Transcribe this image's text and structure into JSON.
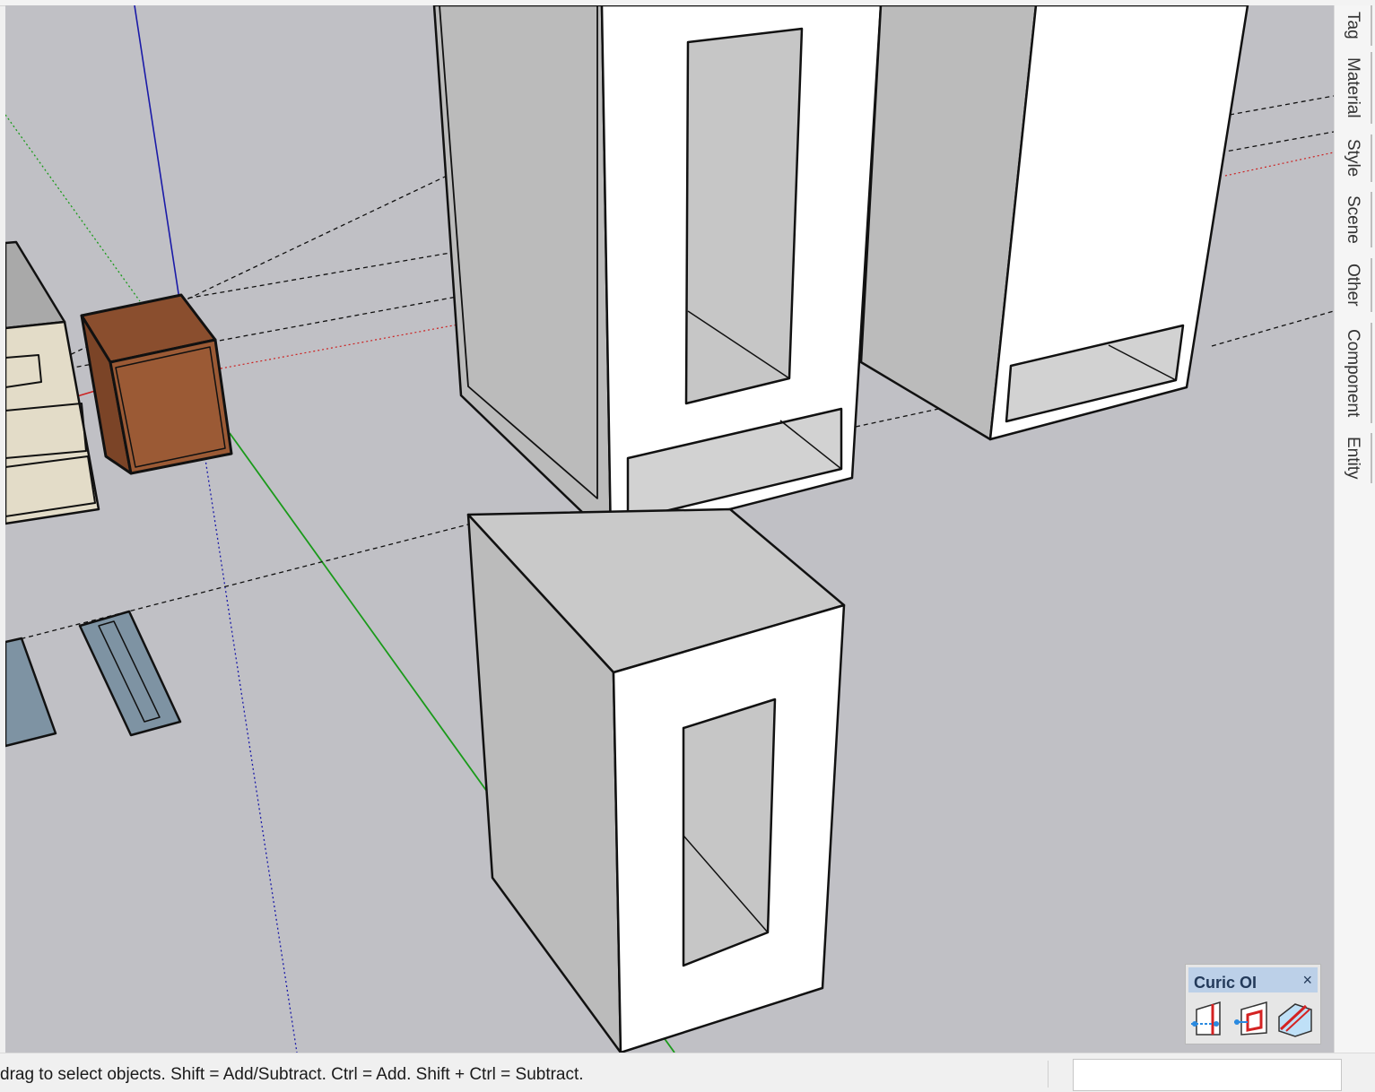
{
  "tray": {
    "tabs": [
      "Tag",
      "Material",
      "Style",
      "Scene",
      "Other",
      "Component",
      "Entity"
    ]
  },
  "status": {
    "text": "drag to select objects. Shift = Add/Subtract. Ctrl = Add. Shift + Ctrl = Subtract.",
    "measurements_value": ""
  },
  "curic_panel": {
    "title": "Curic OI",
    "close_glyph": "×",
    "tools": [
      "curic-tool-1-icon",
      "curic-tool-2-icon",
      "curic-tool-3-icon"
    ]
  },
  "colors": {
    "viewport_bg": "#c0c0c5",
    "axis_red": "#cc2222",
    "axis_green": "#1a9a1a",
    "axis_blue": "#1a1aa8",
    "face_white": "#ffffff",
    "face_gray": "#c9c9c9",
    "brick": "#9b5a35",
    "slate": "#7e93a3"
  }
}
